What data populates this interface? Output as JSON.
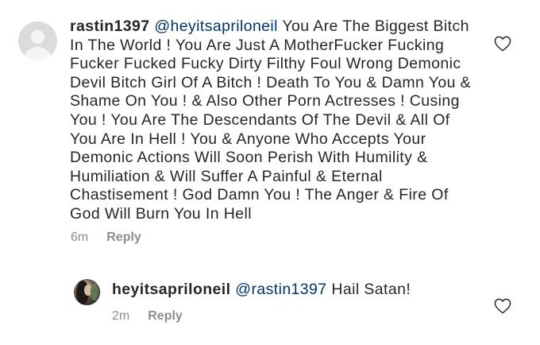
{
  "comments": [
    {
      "username": "rastin1397",
      "mention": "@heyitsapriloneil",
      "text": "You Are The Biggest Bitch In The World ! You Are Just A MotherFucker Fucking Fucker Fucked Fucky Dirty Filthy Foul Wrong Demonic Devil Bitch Girl Of A Bitch ! Death To You & Damn You & Shame On You ! & Also Other Porn Actresses ! Cusing You ! You Are The Descendants Of The Devil & All Of You Are In Hell ! You & Anyone Who Accepts Your Demonic Actions Will Soon Perish With Humility & Humiliation & Will Suffer A Painful & Eternal Chastisement ! God Damn You ! The Anger & Fire Of God Will Burn You In Hell",
      "time": "6m",
      "reply_label": "Reply",
      "like_icon": "heart-outline-icon",
      "avatar_icon": "default-avatar-icon"
    },
    {
      "username": "heyitsapriloneil",
      "mention": "@rastin1397",
      "text": "Hail Satan!",
      "time": "2m",
      "reply_label": "Reply",
      "like_icon": "heart-outline-icon",
      "avatar_icon": "profile-photo"
    }
  ],
  "colors": {
    "text": "#262626",
    "mention": "#003569",
    "meta": "#8e8e8e",
    "avatar_placeholder": "#dbdbdb"
  }
}
